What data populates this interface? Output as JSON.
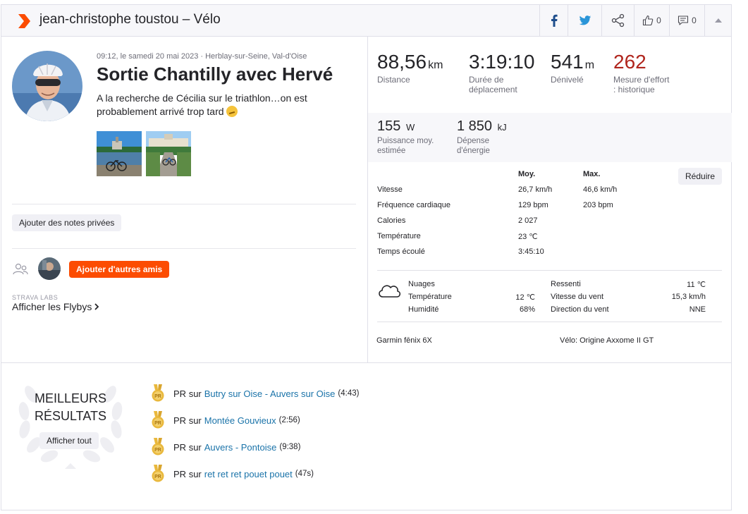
{
  "header": {
    "title": "jean-christophe toustou – Vélo",
    "kudos_count": "0",
    "comments_count": "0"
  },
  "activity": {
    "meta": "09:12, le samedi 20 mai 2023 · Herblay-sur-Seine, Val-d'Oise",
    "title": "Sortie Chantilly avec Hervé",
    "description": "A la recherche de Cécilia sur le triathlon…on est probablement arrivé trop tard",
    "notes_button": "Ajouter des notes privées",
    "add_friends_button": "Ajouter d'autres amis",
    "labs_label": "STRAVA LABS",
    "flybys_link": "Afficher les Flybys"
  },
  "stats": {
    "distance": {
      "value": "88,56",
      "unit": "km",
      "label": "Distance"
    },
    "moving_time": {
      "value": "3:19:10",
      "label": "Durée de déplacement"
    },
    "elevation": {
      "value": "541",
      "unit": "m",
      "label": "Dénivelé"
    },
    "effort": {
      "value": "262",
      "label": "Mesure d'effort : historique"
    },
    "power": {
      "value": "155",
      "unit": "W",
      "label": "Puissance moy. estimée"
    },
    "energy": {
      "value": "1 850",
      "unit": "kJ",
      "label": "Dépense d'énergie"
    }
  },
  "details": {
    "reduce_button": "Réduire",
    "col_avg": "Moy.",
    "col_max": "Max.",
    "rows": [
      {
        "label": "Vitesse",
        "avg": "26,7 km/h",
        "max": "46,6 km/h"
      },
      {
        "label": "Fréquence cardiaque",
        "avg": "129 bpm",
        "max": "203 bpm"
      },
      {
        "label": "Calories",
        "avg": "2 027",
        "max": ""
      },
      {
        "label": "Température",
        "avg": "23 ℃",
        "max": ""
      },
      {
        "label": "Temps écoulé",
        "avg": "3:45:10",
        "max": ""
      }
    ]
  },
  "weather": {
    "condition": "Nuages",
    "temperature_label": "Température",
    "temperature_value": "12 ℃",
    "humidity_label": "Humidité",
    "humidity_value": "68%",
    "feels_label": "Ressenti",
    "feels_value": "11 ℃",
    "wind_speed_label": "Vitesse du vent",
    "wind_speed_value": "15,3 km/h",
    "wind_dir_label": "Direction du vent",
    "wind_dir_value": "NNE"
  },
  "equipment": {
    "device": "Garmin fēnix 6X",
    "bike": "Vélo: Origine Axxome II GT"
  },
  "best_results": {
    "title_line1": "MEILLEURS",
    "title_line2": "RÉSULTATS",
    "show_all": "Afficher tout",
    "pr_label": "PR",
    "sur": "sur",
    "items": [
      {
        "segment": "Butry sur Oise - Auvers sur Oise",
        "time": "(4:43)"
      },
      {
        "segment": "Montée Gouvieux",
        "time": "(2:56)"
      },
      {
        "segment": "Auvers - Pontoise",
        "time": "(9:38)"
      },
      {
        "segment": "ret ret ret pouet pouet",
        "time": "(47s)"
      }
    ]
  },
  "colors": {
    "brand": "#fc4c02",
    "effort_red": "#b0251d",
    "link_blue": "#1a73a9",
    "medal_gold": "#e9b83c"
  }
}
